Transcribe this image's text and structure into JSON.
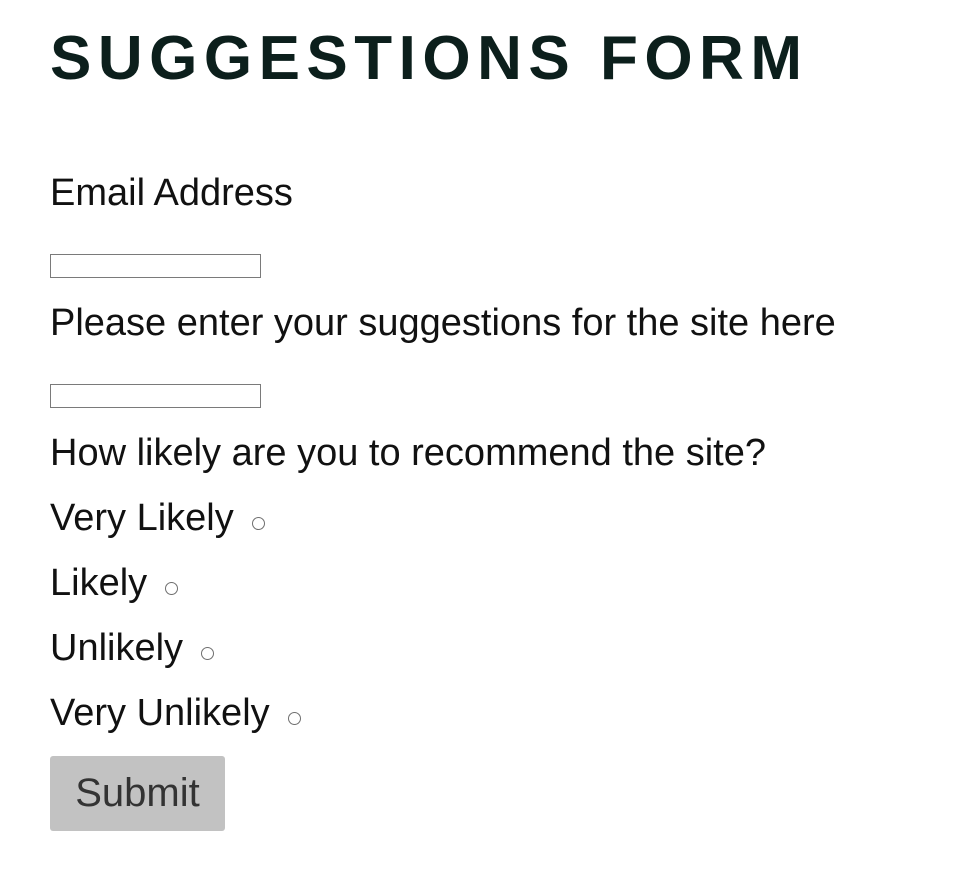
{
  "title": "SUGGESTIONS FORM",
  "fields": {
    "email_label": "Email Address",
    "email_value": "",
    "suggestions_label": "Please enter your suggestions for the site here",
    "suggestions_value": ""
  },
  "recommend": {
    "question": "How likely are you to recommend the site?",
    "options": [
      {
        "label": "Very Likely",
        "checked": false
      },
      {
        "label": "Likely",
        "checked": false
      },
      {
        "label": "Unlikely",
        "checked": false
      },
      {
        "label": "Very Unlikely",
        "checked": false
      }
    ]
  },
  "submit_label": "Submit",
  "colors": {
    "title": "#0c1f1c",
    "text": "#111111",
    "button_bg": "#c2c2c2",
    "button_text": "#333333"
  }
}
